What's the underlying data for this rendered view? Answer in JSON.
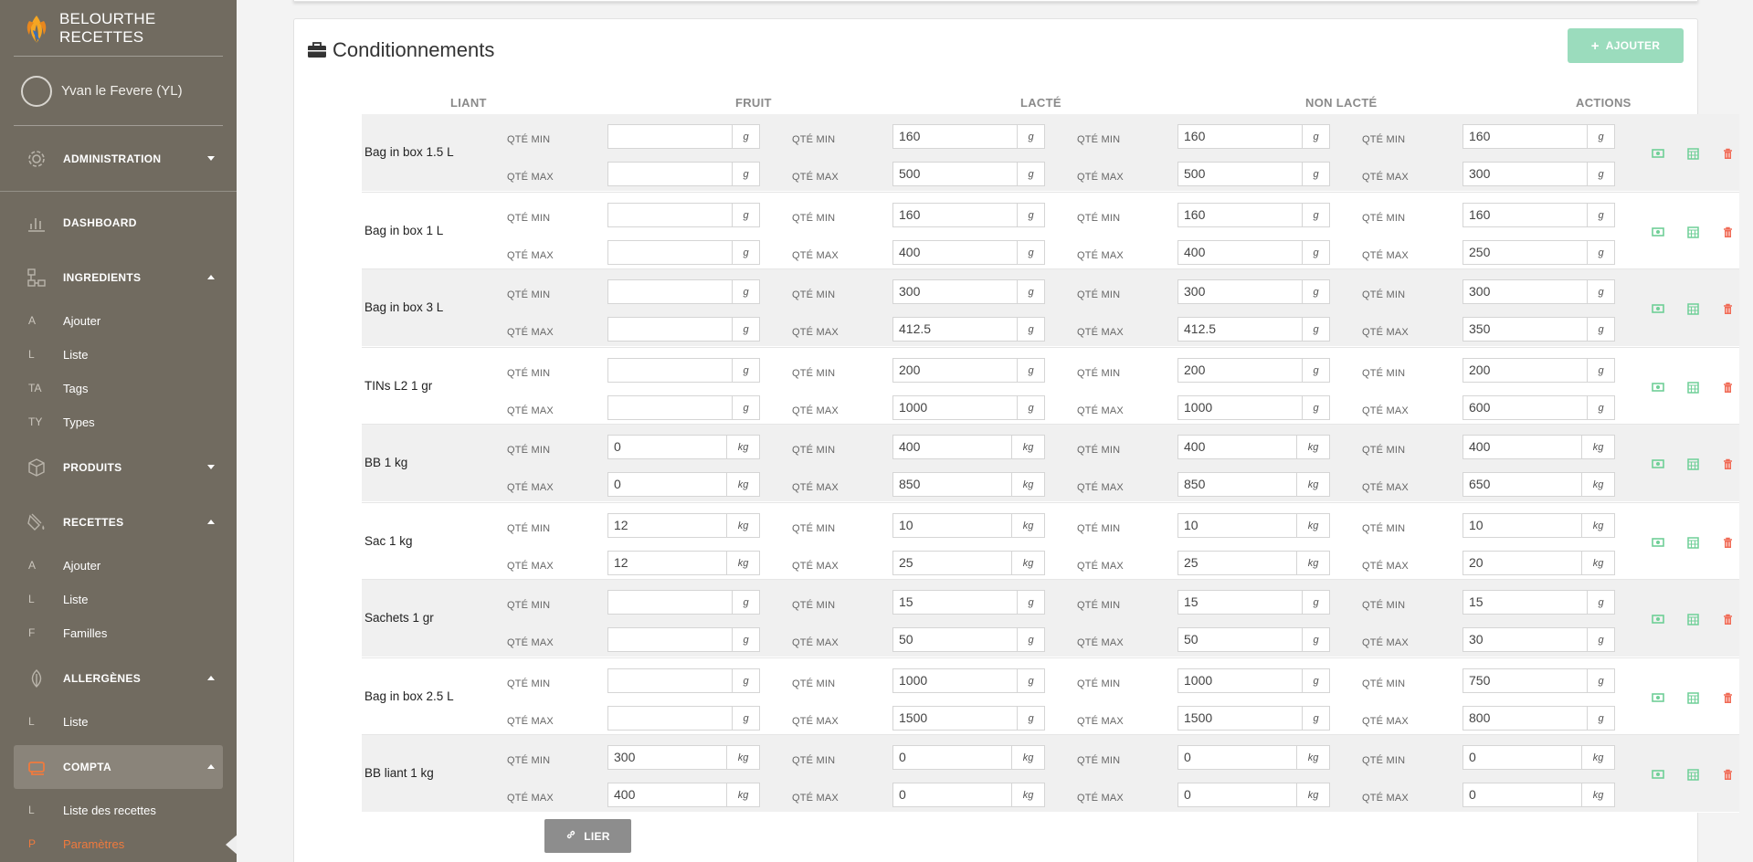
{
  "app": {
    "title": "BELOURTHE RECETTES"
  },
  "user": {
    "name": "Yvan le Fevere (YL)"
  },
  "menu": {
    "administration": "ADMINISTRATION",
    "dashboard": "DASHBOARD",
    "ingredients": "INGREDIENTS",
    "ingredients_items": [
      {
        "abbr": "A",
        "label": "Ajouter"
      },
      {
        "abbr": "L",
        "label": "Liste"
      },
      {
        "abbr": "TA",
        "label": "Tags"
      },
      {
        "abbr": "TY",
        "label": "Types"
      }
    ],
    "produits": "PRODUITS",
    "recettes": "RECETTES",
    "recettes_items": [
      {
        "abbr": "A",
        "label": "Ajouter"
      },
      {
        "abbr": "L",
        "label": "Liste"
      },
      {
        "abbr": "F",
        "label": "Familles"
      }
    ],
    "allergenes": "ALLERGÈNES",
    "allergenes_items": [
      {
        "abbr": "L",
        "label": "Liste"
      }
    ],
    "compta": "COMPTA",
    "compta_items": [
      {
        "abbr": "L",
        "label": "Liste des recettes"
      },
      {
        "abbr": "P",
        "label": "Paramètres"
      }
    ]
  },
  "panel": {
    "title": "Conditionnements",
    "add_label": "AJOUTER",
    "link_label": "LIER",
    "columns": [
      "LIANT",
      "FRUIT",
      "LACTÉ",
      "NON LACTÉ"
    ],
    "actions_header": "ACTIONS",
    "qty_min_label": "QTÉ MIN",
    "qty_max_label": "QTÉ MAX"
  },
  "packages": [
    {
      "name": "Bag in box 1.5 L",
      "unit": "g",
      "min": [
        "",
        "160",
        "160",
        "160"
      ],
      "max": [
        "",
        "500",
        "500",
        "300"
      ]
    },
    {
      "name": "Bag in box 1 L",
      "unit": "g",
      "min": [
        "",
        "160",
        "160",
        "160"
      ],
      "max": [
        "",
        "400",
        "400",
        "250"
      ]
    },
    {
      "name": "Bag in box 3 L",
      "unit": "g",
      "min": [
        "",
        "300",
        "300",
        "300"
      ],
      "max": [
        "",
        "412.5",
        "412.5",
        "350"
      ]
    },
    {
      "name": "TINs L2 1 gr",
      "unit": "g",
      "min": [
        "",
        "200",
        "200",
        "200"
      ],
      "max": [
        "",
        "1000",
        "1000",
        "600"
      ]
    },
    {
      "name": "BB 1 kg",
      "unit": "kg",
      "min": [
        "0",
        "400",
        "400",
        "400"
      ],
      "max": [
        "0",
        "850",
        "850",
        "650"
      ]
    },
    {
      "name": "Sac 1 kg",
      "unit": "kg",
      "min": [
        "12",
        "10",
        "10",
        "10"
      ],
      "max": [
        "12",
        "25",
        "25",
        "20"
      ]
    },
    {
      "name": "Sachets 1 gr",
      "unit": "g",
      "min": [
        "",
        "15",
        "15",
        "15"
      ],
      "max": [
        "",
        "50",
        "50",
        "30"
      ]
    },
    {
      "name": "Bag in box 2.5 L",
      "unit": "g",
      "min": [
        "",
        "1000",
        "1000",
        "750"
      ],
      "max": [
        "",
        "1500",
        "1500",
        "800"
      ]
    },
    {
      "name": "BB liant 1 kg",
      "unit": "kg",
      "min": [
        "300",
        "0",
        "0",
        "0"
      ],
      "max": [
        "400",
        "0",
        "0",
        "0"
      ]
    }
  ],
  "colors": {
    "sidebar": "#716b60",
    "accent_green": "#9bdcbd",
    "action_green": "#6fcf97",
    "action_red": "#f06a55",
    "active_sub": "#f07a3d"
  },
  "icons": {
    "view": "money-icon",
    "calendar": "calendar-icon",
    "delete": "trash-icon"
  }
}
